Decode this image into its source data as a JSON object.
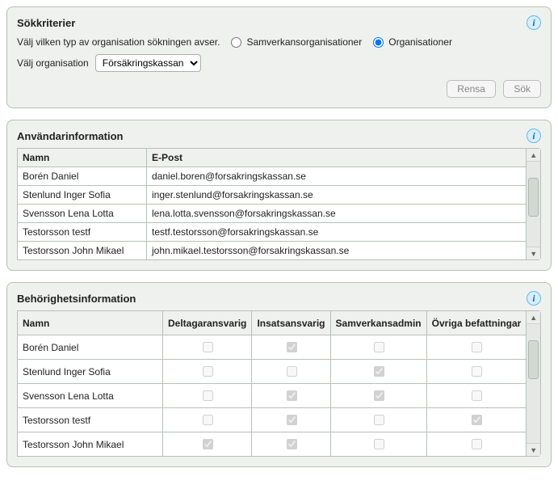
{
  "search": {
    "title": "Sökkriterier",
    "type_label": "Välj vilken typ av organisation sökningen avser.",
    "radio_samverkan": "Samverkansorganisationer",
    "radio_org": "Organisationer",
    "org_label": "Välj organisation",
    "org_selected": "Försäkringskassan",
    "btn_clear": "Rensa",
    "btn_search": "Sök"
  },
  "users": {
    "title": "Användarinformation",
    "col_name": "Namn",
    "col_email": "E-Post",
    "rows": [
      {
        "name": "Borén Daniel",
        "email": "daniel.boren@forsakringskassan.se"
      },
      {
        "name": "Stenlund Inger Sofia",
        "email": "inger.stenlund@forsakringskassan.se"
      },
      {
        "name": "Svensson Lena Lotta",
        "email": "lena.lotta.svensson@forsakringskassan.se"
      },
      {
        "name": "Testorsson testf",
        "email": "testf.testorsson@forsakringskassan.se"
      },
      {
        "name": "Testorsson John Mikael",
        "email": "john.mikael.testorsson@forsakringskassan.se"
      }
    ]
  },
  "perms": {
    "title": "Behörighetsinformation",
    "col_name": "Namn",
    "col_delt": "Deltagaransvarig",
    "col_insats": "Insatsansvarig",
    "col_samv": "Samverkansadmin",
    "col_ovr": "Övriga befattningar",
    "rows": [
      {
        "name": "Borén Daniel",
        "delt": false,
        "insats": true,
        "samv": false,
        "ovr": false
      },
      {
        "name": "Stenlund Inger Sofia",
        "delt": false,
        "insats": false,
        "samv": true,
        "ovr": false
      },
      {
        "name": "Svensson Lena Lotta",
        "delt": false,
        "insats": true,
        "samv": true,
        "ovr": false
      },
      {
        "name": "Testorsson testf",
        "delt": false,
        "insats": true,
        "samv": false,
        "ovr": true
      },
      {
        "name": "Testorsson John Mikael",
        "delt": true,
        "insats": true,
        "samv": false,
        "ovr": false
      }
    ]
  }
}
